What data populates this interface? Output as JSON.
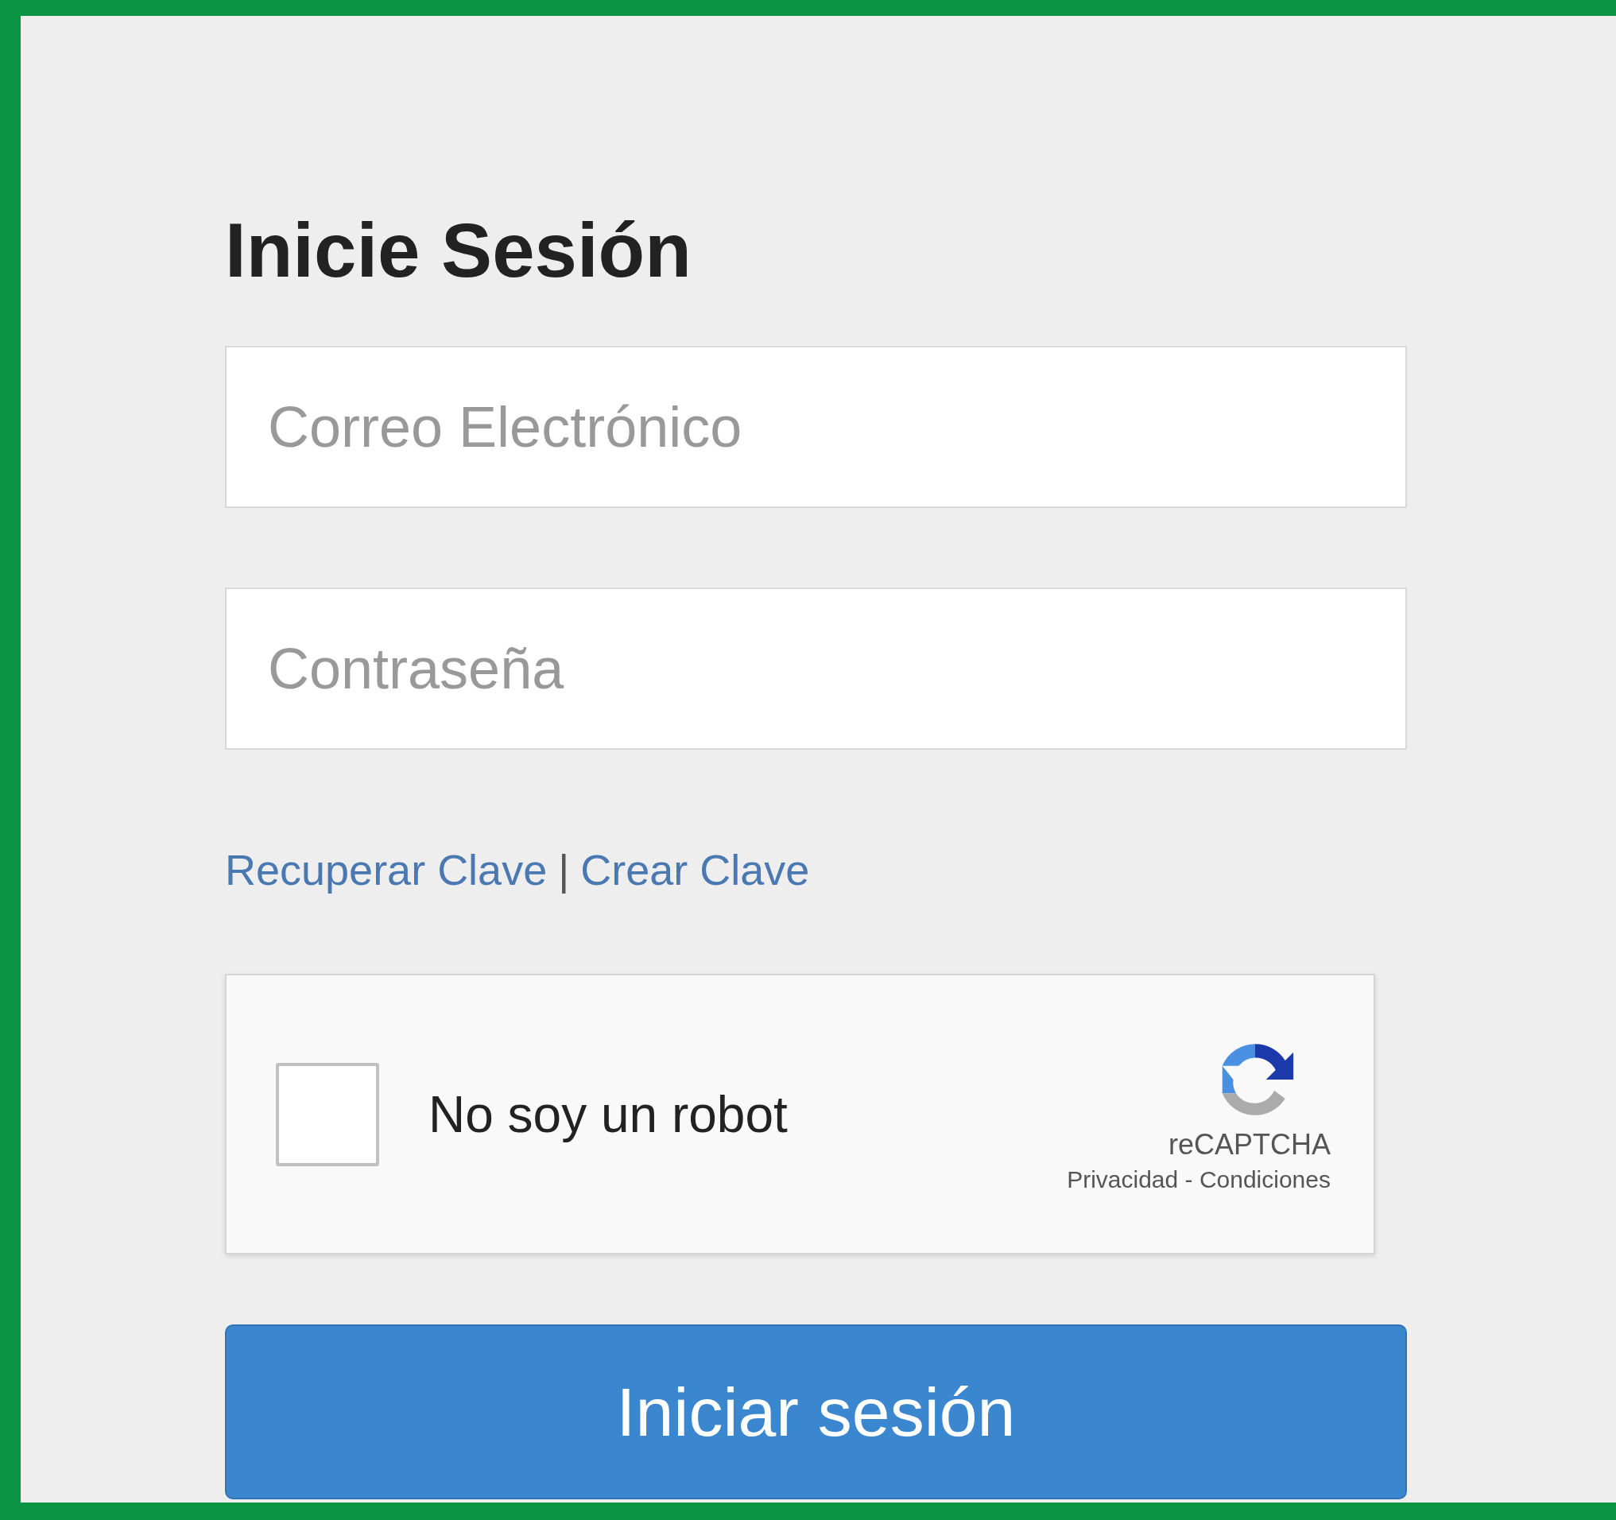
{
  "title": "Inicie Sesión",
  "fields": [
    {
      "placeholder": "Correo Electrónico"
    },
    {
      "placeholder": "Contraseña"
    }
  ],
  "links": [
    "Recuperar Clave",
    "Crear Clave"
  ],
  "link_separator": "|",
  "captcha": {
    "label": "No soy un robot",
    "checked": false,
    "brand": "reCAPTCHA",
    "terms": "Privacidad - Condiciones"
  },
  "submit": "Iniciar sesión"
}
